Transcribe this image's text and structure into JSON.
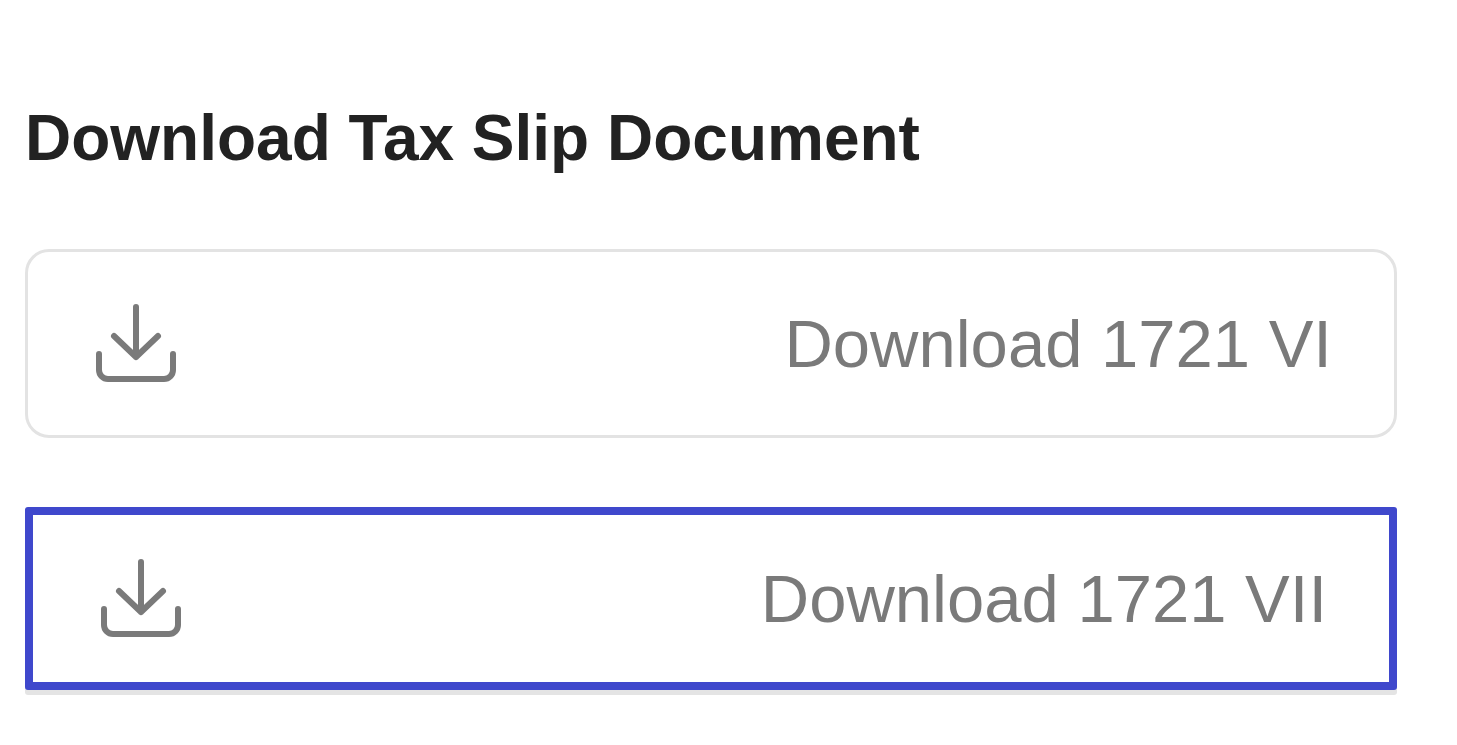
{
  "heading": "Download Tax Slip Document",
  "buttons": [
    {
      "label": "Download 1721 VI",
      "selected": false
    },
    {
      "label": "Download 1721 VII",
      "selected": true
    }
  ]
}
